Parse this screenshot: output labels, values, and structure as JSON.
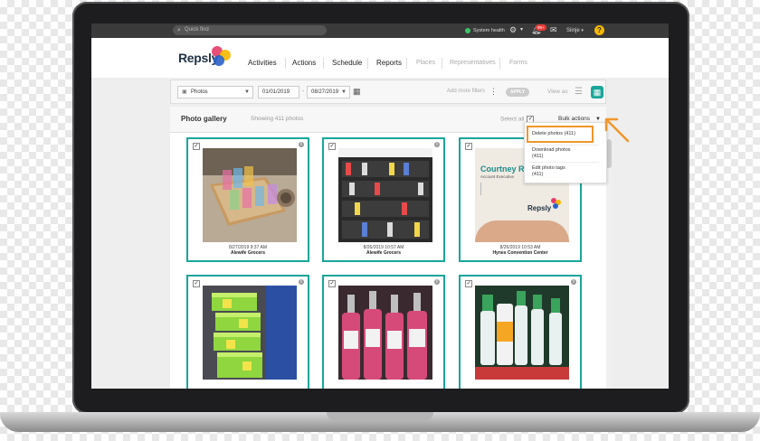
{
  "topbar": {
    "search_placeholder": "Quick find",
    "system_health": "System health",
    "notifications_badge": "99+",
    "user": "Siinje",
    "help": "?"
  },
  "nav": {
    "logo": "Repsly",
    "items": [
      "Activities",
      "Actions",
      "Schedule",
      "Reports"
    ],
    "dim_items": [
      "Places",
      "Representatives",
      "Forms"
    ]
  },
  "filters": {
    "type": "Photos",
    "date_from": "01/01/2019",
    "date_to": "08/27/2019",
    "add_more": "Add more filters",
    "apply": "APPLY",
    "view_as": "View as"
  },
  "gallery": {
    "title": "Photo gallery",
    "showing": "Showing 411 photos",
    "select_all": "Select all",
    "bulk_actions": "Bulk actions",
    "cards": [
      {
        "date": "8/27/2019 9:37 AM",
        "location": "Alewife Grocers"
      },
      {
        "date": "8/26/2019 10:57 AM",
        "location": "Alewife Grocers"
      },
      {
        "date": "8/26/2019 10:53 AM",
        "location": "Hynes Convention Center"
      },
      {
        "date": "",
        "location": ""
      },
      {
        "date": "",
        "location": ""
      },
      {
        "date": "",
        "location": ""
      }
    ]
  },
  "bulk_menu": {
    "delete": "Delete photos (411)",
    "download_1": "Download photos",
    "download_2": "(411)",
    "edit_1": "Edit photo tags",
    "edit_2": "(411)"
  },
  "business_card": {
    "name": "Courtney Raya",
    "title": "Account Executive",
    "brand": "Repsly"
  },
  "colors": {
    "accent": "#1aa69a",
    "highlight": "#f0962b",
    "topbar": "#3a3a3a"
  }
}
